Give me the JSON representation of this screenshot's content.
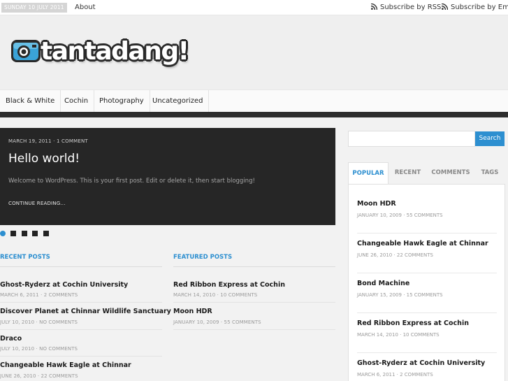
{
  "topbar": {
    "date": "SUNDAY 10 JULY 2011",
    "about": "About",
    "subscribe_rss": "Subscribe by RSS",
    "subscribe_email": "Subscribe by Email",
    "rss_icon": "rss-icon"
  },
  "logo": {
    "text": "tantadang!",
    "icon": "camera-icon"
  },
  "nav": {
    "items": [
      "Black & White",
      "Cochin",
      "Photography",
      "Uncategorized"
    ]
  },
  "slider": {
    "meta": "MARCH 19, 2011 · 1 COMMENT",
    "title": "Hello world!",
    "excerpt": "Welcome to WordPress. This is your first post. Edit or delete it, then start blogging!",
    "more": "CONTINUE READING..."
  },
  "recent": {
    "title": "RECENT POSTS",
    "posts": [
      {
        "title": "Ghost-Ryderz at Cochin University",
        "meta": "MARCH 6, 2011 · 2 COMMENTS"
      },
      {
        "title": "Discover Planet at Chinnar Wildlife Sanctuary",
        "meta": "JULY 10, 2010 · NO COMMENTS"
      },
      {
        "title": "Draco",
        "meta": "JULY 10, 2010 · NO COMMENTS"
      },
      {
        "title": "Changeable Hawk Eagle at Chinnar",
        "meta": "JUNE 26, 2010 · 22 COMMENTS"
      }
    ]
  },
  "featured": {
    "title": "FEATURED POSTS",
    "posts": [
      {
        "title": "Red Ribbon Express at Cochin",
        "meta": "MARCH 14, 2010 · 10 COMMENTS"
      },
      {
        "title": "Moon HDR",
        "meta": "JANUARY 10, 2009 · 55 COMMENTS"
      }
    ]
  },
  "search": {
    "button": "Search",
    "placeholder": ""
  },
  "tabs": {
    "items": [
      "POPULAR",
      "RECENT",
      "COMMENTS",
      "TAGS"
    ],
    "popular": [
      {
        "title": "Moon HDR",
        "meta": "JANUARY 10, 2009 · 55 COMMENTS"
      },
      {
        "title": "Changeable Hawk Eagle at Chinnar",
        "meta": "JUNE 26, 2010 · 22 COMMENTS"
      },
      {
        "title": "Bond Machine",
        "meta": "JANUARY 15, 2009 · 15 COMMENTS"
      },
      {
        "title": "Red Ribbon Express at Cochin",
        "meta": "MARCH 14, 2010 · 10 COMMENTS"
      },
      {
        "title": "Ghost-Ryderz at Cochin University",
        "meta": "MARCH 6, 2011 · 2 COMMENTS"
      }
    ]
  },
  "colors": {
    "accent": "#2d8fd0",
    "dark": "#262626"
  }
}
